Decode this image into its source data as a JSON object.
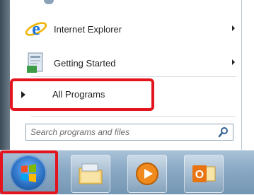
{
  "start_menu": {
    "pinned": [
      {
        "label": "Internet Explorer",
        "icon": "internet-explorer-icon",
        "has_submenu": true
      },
      {
        "label": "Getting Started",
        "icon": "getting-started-icon",
        "has_submenu": true
      }
    ],
    "all_programs_label": "All Programs",
    "search_placeholder": "Search programs and files",
    "highlight_color": "#e3141e"
  },
  "taskbar": {
    "items": [
      {
        "name": "start-orb",
        "icon": "windows-logo-icon"
      },
      {
        "name": "windows-explorer",
        "icon": "folder-icon"
      },
      {
        "name": "media-player",
        "icon": "media-player-icon"
      },
      {
        "name": "outlook",
        "icon": "outlook-icon"
      }
    ]
  }
}
